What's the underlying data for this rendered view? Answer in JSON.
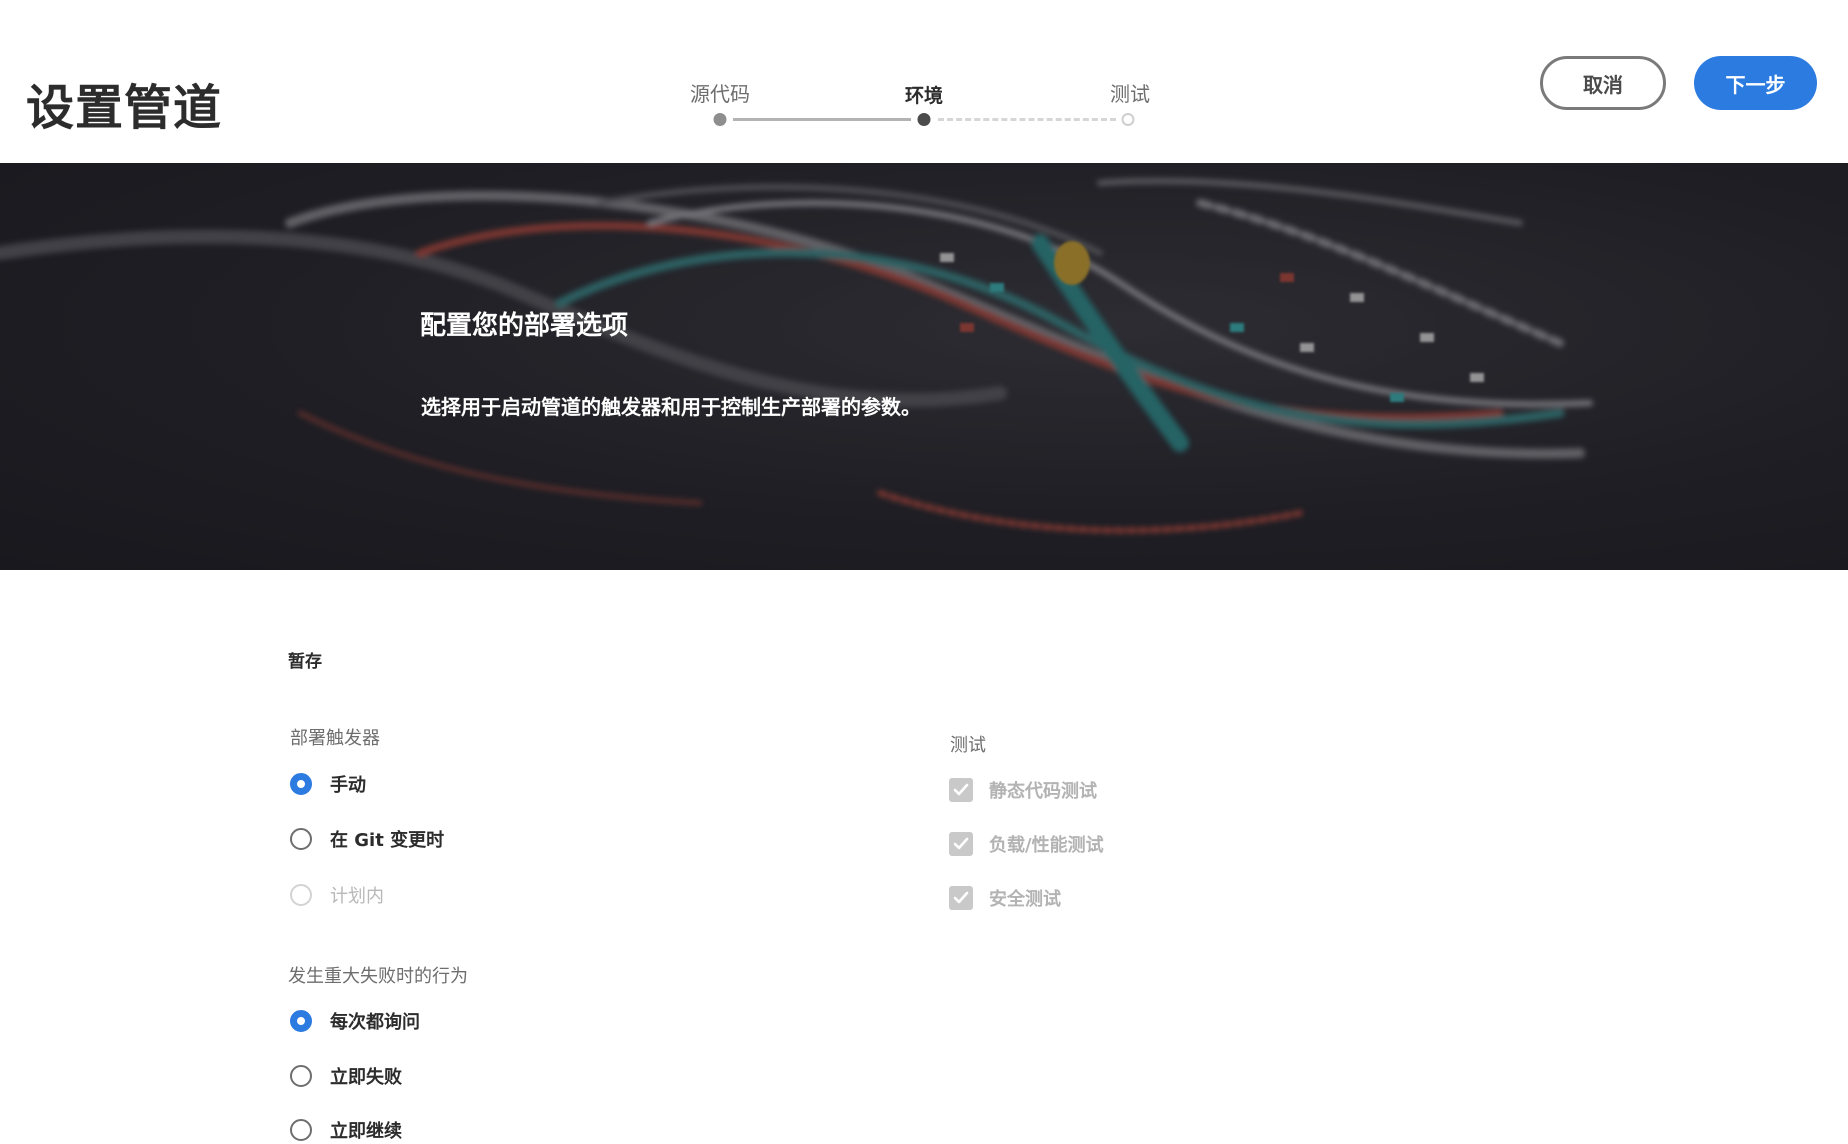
{
  "header": {
    "title": "设置管道",
    "steps": [
      {
        "label": "源代码",
        "state": "done"
      },
      {
        "label": "环境",
        "state": "current"
      },
      {
        "label": "测试",
        "state": "todo"
      }
    ],
    "cancel_label": "取消",
    "next_label": "下一步"
  },
  "hero": {
    "title": "配置您的部署选项",
    "subtitle": "选择用于启动管道的触发器和用于控制生产部署的参数。"
  },
  "form": {
    "section_heading": "暂存",
    "deploy_trigger": {
      "label": "部署触发器",
      "options": [
        {
          "label": "手动",
          "selected": true,
          "disabled": false
        },
        {
          "label": "在 Git 变更时",
          "selected": false,
          "disabled": false
        },
        {
          "label": "计划内",
          "selected": false,
          "disabled": true
        }
      ]
    },
    "failure_behavior": {
      "label": "发生重大失败时的行为",
      "options": [
        {
          "label": "每次都询问",
          "selected": true
        },
        {
          "label": "立即失败",
          "selected": false
        },
        {
          "label": "立即继续",
          "selected": false
        }
      ]
    },
    "tests": {
      "label": "测试",
      "items": [
        {
          "label": "静态代码测试",
          "checked": true,
          "disabled": true
        },
        {
          "label": "负载/性能测试",
          "checked": true,
          "disabled": true
        },
        {
          "label": "安全测试",
          "checked": true,
          "disabled": true
        }
      ]
    }
  },
  "colors": {
    "accent": "#2c7be0",
    "text": "#2c2c2c",
    "muted": "#6e6e6e",
    "disabled": "#b8b8b8",
    "hero_bg": "#24242a"
  }
}
